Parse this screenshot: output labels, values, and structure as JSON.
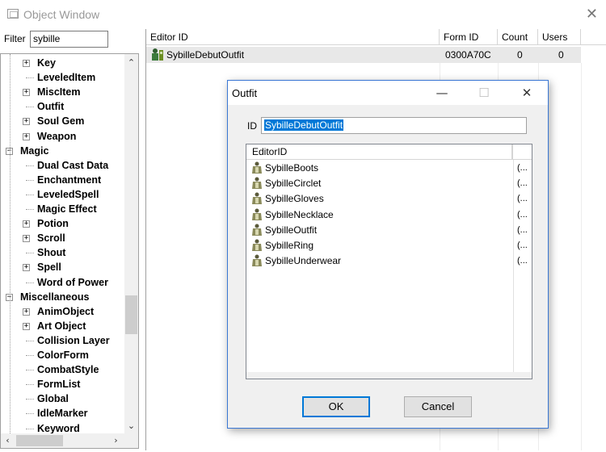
{
  "window": {
    "title": "Object Window"
  },
  "filter": {
    "label": "Filter",
    "value": "sybille"
  },
  "tree": {
    "items": [
      {
        "label": "Key",
        "expandable": true
      },
      {
        "label": "LeveledItem",
        "expandable": false
      },
      {
        "label": "MiscItem",
        "expandable": true
      },
      {
        "label": "Outfit",
        "expandable": false
      },
      {
        "label": "Soul Gem",
        "expandable": true
      },
      {
        "label": "Weapon",
        "expandable": true
      },
      {
        "label": "Magic",
        "expandable": true,
        "expanded": true
      },
      {
        "label": "Dual Cast Data",
        "expandable": false
      },
      {
        "label": "Enchantment",
        "expandable": false
      },
      {
        "label": "LeveledSpell",
        "expandable": false
      },
      {
        "label": "Magic Effect",
        "expandable": false
      },
      {
        "label": "Potion",
        "expandable": true
      },
      {
        "label": "Scroll",
        "expandable": true
      },
      {
        "label": "Shout",
        "expandable": false
      },
      {
        "label": "Spell",
        "expandable": true
      },
      {
        "label": "Word of Power",
        "expandable": false
      },
      {
        "label": "Miscellaneous",
        "expandable": true,
        "expanded": true
      },
      {
        "label": "AnimObject",
        "expandable": true
      },
      {
        "label": "Art Object",
        "expandable": true
      },
      {
        "label": "Collision Layer",
        "expandable": false
      },
      {
        "label": "ColorForm",
        "expandable": false
      },
      {
        "label": "CombatStyle",
        "expandable": false
      },
      {
        "label": "FormList",
        "expandable": false
      },
      {
        "label": "Global",
        "expandable": false
      },
      {
        "label": "IdleMarker",
        "expandable": false
      },
      {
        "label": "Keyword",
        "expandable": false
      }
    ]
  },
  "list": {
    "columns": [
      "Editor ID",
      "Form ID",
      "Count",
      "Users"
    ],
    "rows": [
      {
        "editor_id": "SybilleDebutOutfit",
        "form_id": "0300A70C",
        "count": "0",
        "users": "0"
      }
    ]
  },
  "dialog": {
    "title": "Outfit",
    "id_label": "ID",
    "id_value": "SybilleDebutOutfit",
    "list_header": "EditorID",
    "items": [
      {
        "name": "SybilleBoots",
        "extra": "(..."
      },
      {
        "name": "SybilleCirclet",
        "extra": "(..."
      },
      {
        "name": "SybilleGloves",
        "extra": "(..."
      },
      {
        "name": "SybilleNecklace",
        "extra": "(..."
      },
      {
        "name": "SybilleOutfit",
        "extra": "(..."
      },
      {
        "name": "SybilleRing",
        "extra": "(..."
      },
      {
        "name": "SybilleUnderwear",
        "extra": "(..."
      }
    ],
    "ok_label": "OK",
    "cancel_label": "Cancel",
    "minimize_glyph": "—",
    "maximize_glyph": "☐",
    "close_glyph": "✕"
  },
  "colors": {
    "selection": "#0078d7",
    "dialog_border": "#3a77d4",
    "row_highlight": "#e8e8e8"
  }
}
